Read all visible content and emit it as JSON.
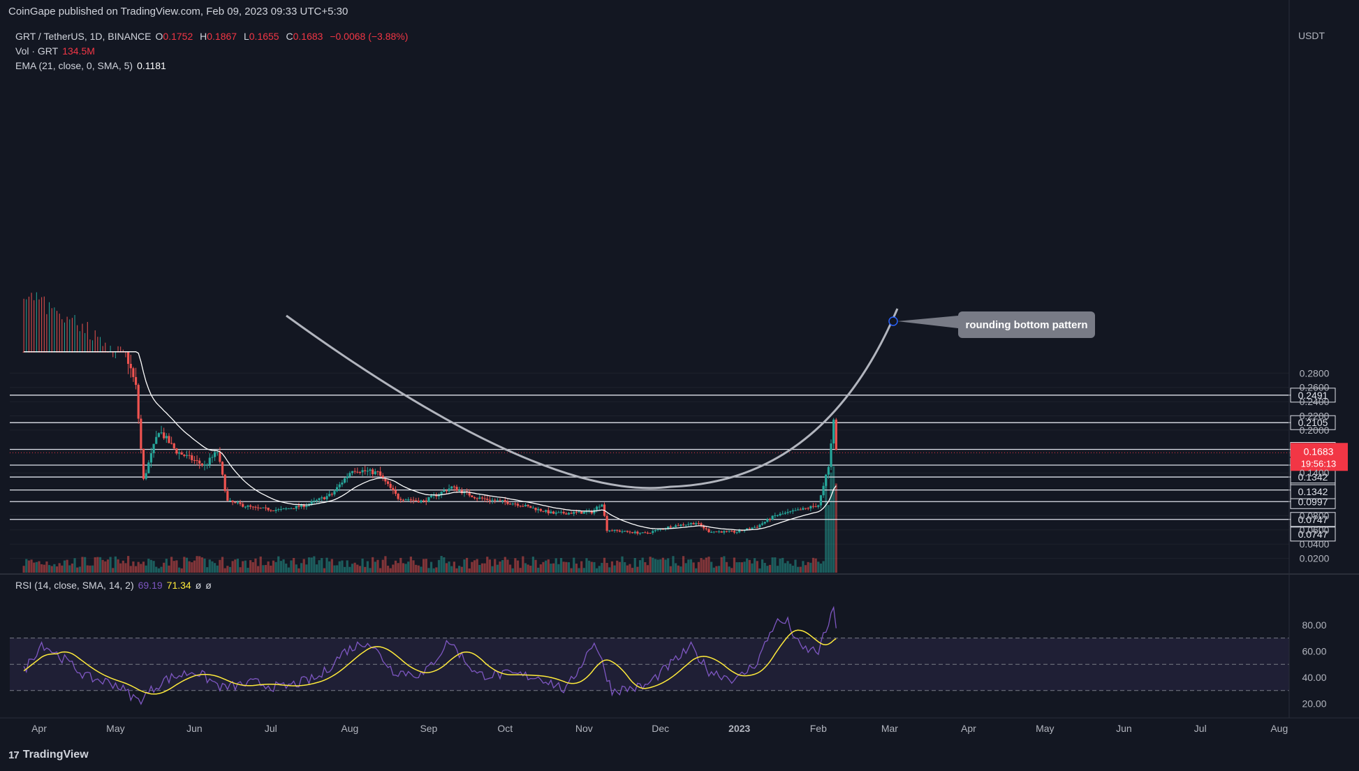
{
  "header": {
    "published_by": "CoinGape published on TradingView.com, Feb 09, 2023 09:33 UTC+5:30"
  },
  "legend": {
    "symbol": "GRT / TetherUS, 1D, BINANCE",
    "o_label": "O",
    "o": "0.1752",
    "h_label": "H",
    "h": "0.1867",
    "l_label": "L",
    "l": "0.1655",
    "c_label": "C",
    "c": "0.1683",
    "change": "−0.0068 (−3.88%)",
    "vol_label": "Vol · GRT",
    "vol": "134.5M",
    "ema_label": "EMA (21, close, 0, SMA, 5)",
    "ema": "0.1181"
  },
  "rsi_legend": {
    "label": "RSI (14, close, SMA, 14, 2)",
    "rsi": "69.19",
    "rsi_ma": "71.34",
    "na1": "ø",
    "na2": "ø"
  },
  "currency": "USDT",
  "annotation": {
    "text": "rounding bottom pattern"
  },
  "footer": {
    "brand": "TradingView",
    "logo": "17"
  },
  "colors": {
    "background": "#131722",
    "up": "#26a69a",
    "down": "#ef5350",
    "ema": "#ffffff",
    "rsi": "#7e57c2",
    "rsi_ma": "#ffeb3b",
    "last_price": "#f23645",
    "rsi_band": "#7e57c2"
  },
  "chart_data": [
    {
      "type": "candlestick",
      "title": "GRT / TetherUS, 1D, BINANCE",
      "x_axis_labels": [
        "Apr",
        "May",
        "Jun",
        "Jul",
        "Aug",
        "Sep",
        "Oct",
        "Nov",
        "Dec",
        "2023",
        "Feb",
        "Mar",
        "Apr",
        "May",
        "Jun",
        "Jul",
        "Aug"
      ],
      "y_axis_ticks": [
        "0.2800",
        "0.2600",
        "0.2400",
        "0.2200",
        "0.2000",
        "0.1400",
        "0.0800",
        "0.0600",
        "0.0400",
        "0.0200"
      ],
      "ylim": [
        0.0,
        0.305
      ],
      "ohlc_path": [
        [
          "2022-03-26",
          0.4
        ],
        [
          "2022-04-15",
          0.36
        ],
        [
          "2022-05-05",
          0.31
        ],
        [
          "2022-05-09",
          0.26
        ],
        [
          "2022-05-12",
          0.13
        ],
        [
          "2022-05-18",
          0.2
        ],
        [
          "2022-05-25",
          0.17
        ],
        [
          "2022-06-05",
          0.15
        ],
        [
          "2022-06-10",
          0.17
        ],
        [
          "2022-06-14",
          0.1
        ],
        [
          "2022-06-25",
          0.09
        ],
        [
          "2022-07-05",
          0.088
        ],
        [
          "2022-07-15",
          0.095
        ],
        [
          "2022-07-25",
          0.11
        ],
        [
          "2022-08-02",
          0.145
        ],
        [
          "2022-08-12",
          0.14
        ],
        [
          "2022-08-20",
          0.105
        ],
        [
          "2022-08-30",
          0.1
        ],
        [
          "2022-09-10",
          0.12
        ],
        [
          "2022-09-20",
          0.105
        ],
        [
          "2022-10-05",
          0.097
        ],
        [
          "2022-10-20",
          0.083
        ],
        [
          "2022-11-04",
          0.085
        ],
        [
          "2022-11-08",
          0.098
        ],
        [
          "2022-11-10",
          0.06
        ],
        [
          "2022-11-25",
          0.055
        ],
        [
          "2022-12-05",
          0.065
        ],
        [
          "2022-12-15",
          0.07
        ],
        [
          "2022-12-20",
          0.058
        ],
        [
          "2022-12-31",
          0.057
        ],
        [
          "2023-01-08",
          0.065
        ],
        [
          "2023-01-15",
          0.08
        ],
        [
          "2023-01-25",
          0.088
        ],
        [
          "2023-02-01",
          0.095
        ],
        [
          "2023-02-03",
          0.12
        ],
        [
          "2023-02-05",
          0.15
        ],
        [
          "2023-02-06",
          0.18
        ],
        [
          "2023-02-07",
          0.21
        ],
        [
          "2023-02-08",
          0.1752
        ],
        [
          "2023-02-09",
          0.1683
        ]
      ],
      "last": {
        "o": 0.1752,
        "h": 0.1867,
        "l": 0.1655,
        "c": 0.1683,
        "change": -0.0068,
        "change_pct": -3.88
      },
      "ema_21": 0.1181,
      "horizontal_levels": [
        "0.2491",
        "0.2105",
        "0.1730",
        "0.1509",
        "0.1342",
        "0.1160",
        "0.0997",
        "0.0747"
      ],
      "extra_level_labels": [
        "0.1342",
        "0.0747"
      ],
      "last_price_label": "0.1683",
      "countdown": "19:56:13",
      "volume_last": "134.5M"
    },
    {
      "type": "line",
      "title": "RSI (14, close, SMA, 14, 2)",
      "y_axis_ticks": [
        "80.00",
        "60.00",
        "40.00",
        "20.00"
      ],
      "ylim": [
        15,
        97
      ],
      "bands": [
        30,
        50,
        70
      ],
      "rsi_path": [
        [
          "2022-03-26",
          45
        ],
        [
          "2022-04-02",
          66
        ],
        [
          "2022-04-10",
          55
        ],
        [
          "2022-04-20",
          40
        ],
        [
          "2022-05-01",
          35
        ],
        [
          "2022-05-10",
          22
        ],
        [
          "2022-05-20",
          38
        ],
        [
          "2022-06-01",
          45
        ],
        [
          "2022-06-12",
          32
        ],
        [
          "2022-06-25",
          36
        ],
        [
          "2022-07-05",
          32
        ],
        [
          "2022-07-20",
          40
        ],
        [
          "2022-07-30",
          60
        ],
        [
          "2022-08-08",
          68
        ],
        [
          "2022-08-18",
          45
        ],
        [
          "2022-08-30",
          42
        ],
        [
          "2022-09-09",
          68
        ],
        [
          "2022-09-20",
          42
        ],
        [
          "2022-10-05",
          42
        ],
        [
          "2022-10-15",
          40
        ],
        [
          "2022-10-25",
          30
        ],
        [
          "2022-11-05",
          68
        ],
        [
          "2022-11-12",
          30
        ],
        [
          "2022-11-25",
          33
        ],
        [
          "2022-12-05",
          50
        ],
        [
          "2022-12-13",
          63
        ],
        [
          "2022-12-20",
          45
        ],
        [
          "2022-12-31",
          38
        ],
        [
          "2023-01-08",
          52
        ],
        [
          "2023-01-15",
          82
        ],
        [
          "2023-01-20",
          82
        ],
        [
          "2023-01-25",
          62
        ],
        [
          "2023-02-01",
          60
        ],
        [
          "2023-02-07",
          91
        ],
        [
          "2023-02-09",
          69.19
        ]
      ],
      "rsi": 69.19,
      "rsi_ma": 71.34
    }
  ]
}
